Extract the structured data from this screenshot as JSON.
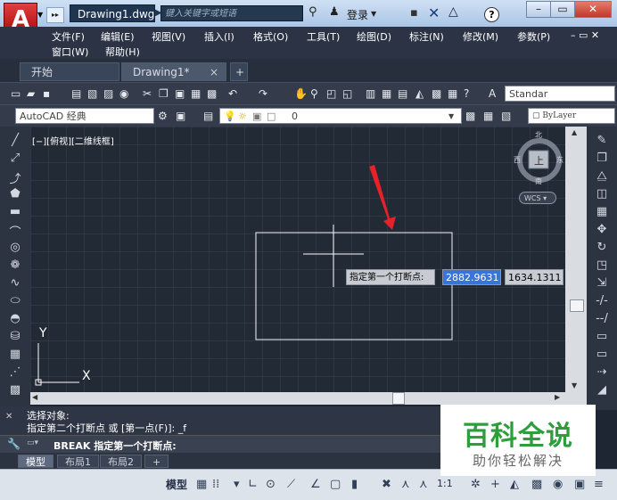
{
  "titlebar": {
    "logo_letter": "A",
    "doc_tab": "Drawing1.dwg",
    "search_placeholder": "键入关键字或短语",
    "login_label": "登录",
    "help_label": "?",
    "win_minimize": "–",
    "win_restore": "▭",
    "win_close": "✕"
  },
  "menubar": {
    "items": [
      "文件(F)",
      "编辑(E)",
      "视图(V)",
      "插入(I)",
      "格式(O)",
      "工具(T)",
      "绘图(D)",
      "标注(N)",
      "修改(M)",
      "参数(P)"
    ],
    "items_row2": [
      "窗口(W)",
      "帮助(H)"
    ],
    "win_controls": "– ▭ ✕"
  },
  "filetabs": {
    "tabs": [
      {
        "label": "开始"
      },
      {
        "label": "Drawing1*"
      }
    ],
    "close_label": "×",
    "add_label": "+"
  },
  "toolbar1": {
    "style_combo": "Standar"
  },
  "toolbar2": {
    "workspace_combo": "AutoCAD 经典",
    "layer_value": "0",
    "color_combo": "ByLayer"
  },
  "viewport": {
    "label": "[−][俯视][二维线框]",
    "compass": {
      "north": "北",
      "south": "南",
      "west": "西",
      "east": "东",
      "top": "上"
    },
    "wcs_label": "WCS",
    "ucs_y": "Y",
    "ucs_x": "X"
  },
  "dynamic_input": {
    "prompt": "指定第一个打断点:",
    "x_value": "2882.9631",
    "y_value": "1634.1311"
  },
  "command": {
    "history": [
      "选择对象:",
      "指定第二个打断点 或 [第一点(F)]: _f"
    ],
    "current": "BREAK 指定第一个打断点:"
  },
  "layouttabs": {
    "tabs": [
      {
        "label": "模型"
      },
      {
        "label": "布局1"
      },
      {
        "label": "布局2"
      }
    ],
    "add_label": "+"
  },
  "statusbar": {
    "model_label": "模型",
    "scale_label": "1:1"
  },
  "watermark": {
    "title": "百科全说",
    "subtitle": "助你轻松解决"
  },
  "colors": {
    "canvas_bg": "#222a36",
    "highlight_input": "#3875d7",
    "annotation_arrow": "#e8202a",
    "watermark_green": "#2e9e3c"
  }
}
